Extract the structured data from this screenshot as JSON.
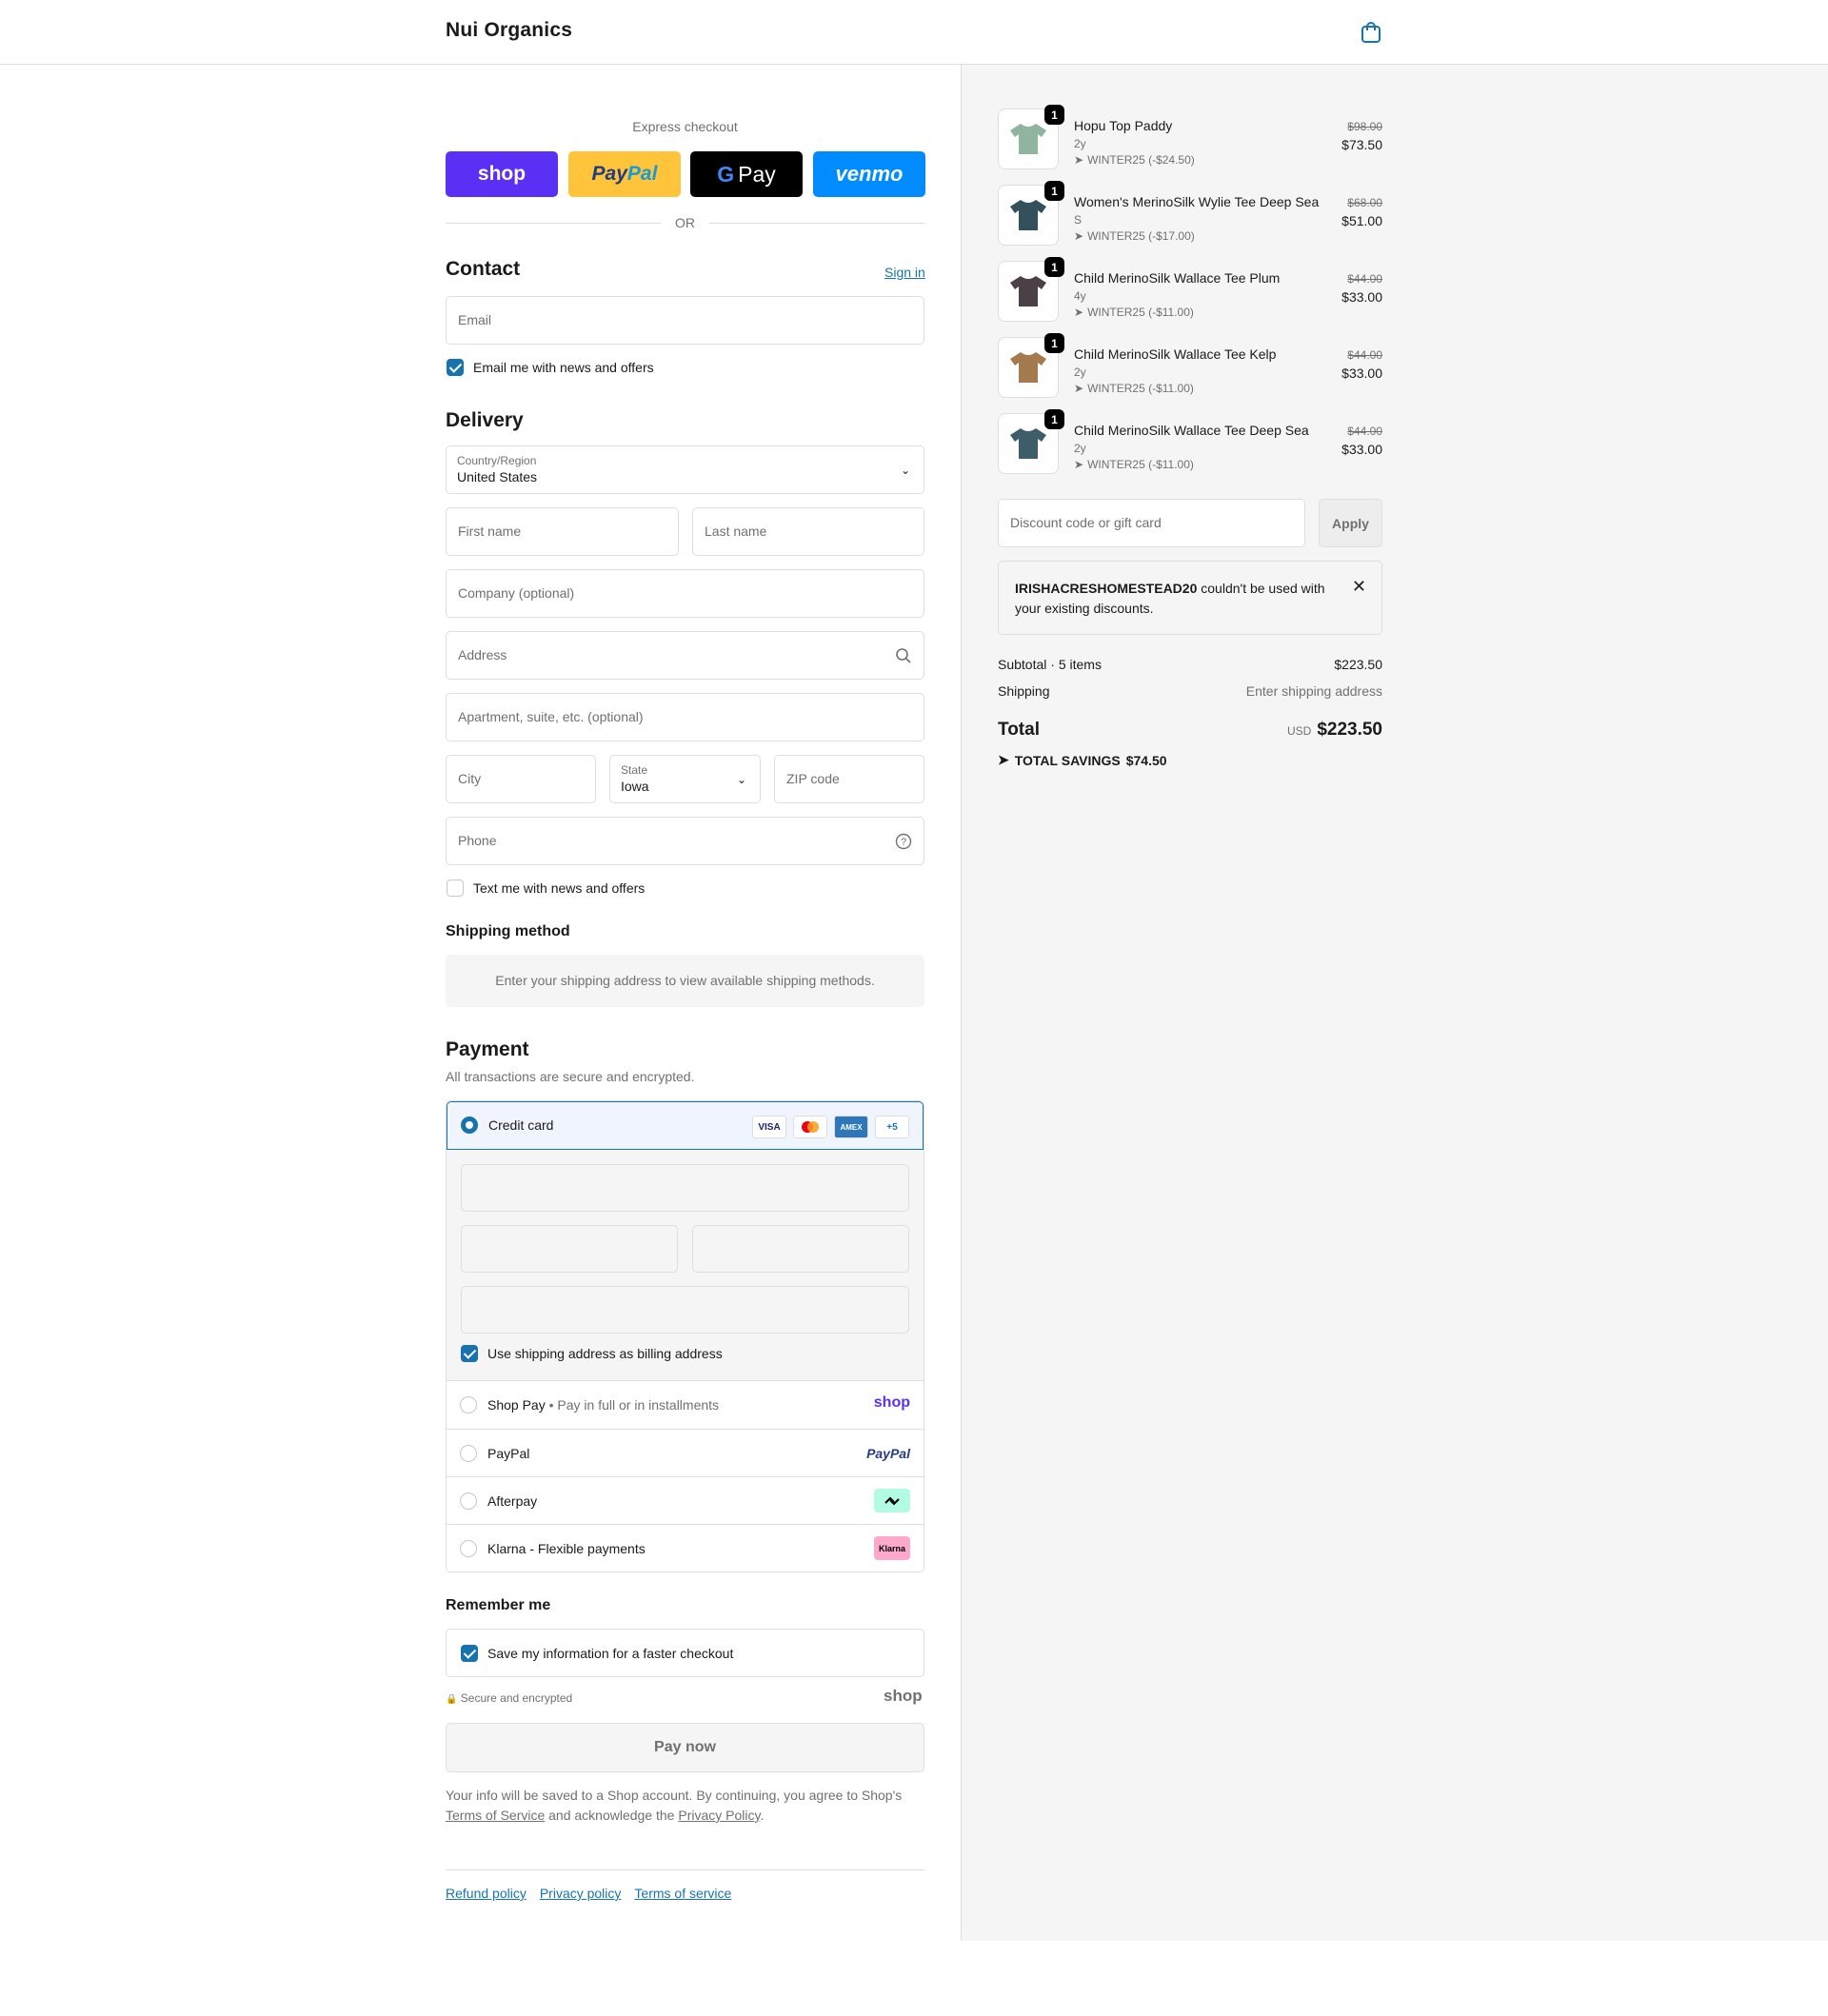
{
  "header": {
    "brand": "Nui Organics"
  },
  "express": {
    "label": "Express checkout",
    "shop": "shop",
    "paypal_a": "Pay",
    "paypal_b": "Pal",
    "gpay_g": "G",
    "gpay": "Pay",
    "venmo": "venmo",
    "or": "OR"
  },
  "contact": {
    "title": "Contact",
    "sign_in": "Sign in",
    "email_placeholder": "Email",
    "email_optin": "Email me with news and offers"
  },
  "delivery": {
    "title": "Delivery",
    "country_label": "Country/Region",
    "country_value": "United States",
    "first_name": "First name",
    "last_name": "Last name",
    "company": "Company (optional)",
    "address": "Address",
    "apartment": "Apartment, suite, etc. (optional)",
    "city": "City",
    "state_label": "State",
    "state_value": "Iowa",
    "zip": "ZIP code",
    "phone": "Phone",
    "text_optin": "Text me with news and offers"
  },
  "shipping_method": {
    "title": "Shipping method",
    "message": "Enter your shipping address to view available shipping methods."
  },
  "payment": {
    "title": "Payment",
    "subtitle": "All transactions are secure and encrypted.",
    "credit_card": "Credit card",
    "cards": [
      "VISA",
      "MC",
      "AMEX",
      "+5"
    ],
    "billing_same": "Use shipping address as billing address",
    "options": [
      {
        "label": "Shop Pay",
        "sub": "Pay in full or in installments",
        "logo": "shop"
      },
      {
        "label": "PayPal",
        "sub": "",
        "logo": "PayPal"
      },
      {
        "label": "Afterpay",
        "sub": "",
        "logo": "afterpay"
      },
      {
        "label": "Klarna - Flexible payments",
        "sub": "",
        "logo": "Klarna"
      }
    ]
  },
  "remember": {
    "title": "Remember me",
    "save_info": "Save my information for a faster checkout",
    "secure": "Secure and encrypted",
    "shop_logo": "shop"
  },
  "pay_now": "Pay now",
  "legal": {
    "text1": "Your info will be saved to a Shop account. By continuing, you agree to Shop's",
    "terms": "Terms of Service",
    "text2": "and acknowledge the",
    "privacy": "Privacy Policy",
    "text3": "."
  },
  "footer": [
    "Refund policy",
    "Privacy policy",
    "Terms of service"
  ],
  "order": {
    "items": [
      {
        "name": "Hopu Top Paddy",
        "variant": "2y",
        "discount": "WINTER25 (-$24.50)",
        "old": "$98.00",
        "price": "$73.50",
        "qty": "1",
        "color": "#8fb4a0"
      },
      {
        "name": "Women's MerinoSilk Wylie Tee Deep Sea",
        "variant": "S",
        "discount": "WINTER25 (-$17.00)",
        "old": "$68.00",
        "price": "$51.00",
        "qty": "1",
        "color": "#33505c"
      },
      {
        "name": "Child MerinoSilk Wallace Tee Plum",
        "variant": "4y",
        "discount": "WINTER25 (-$11.00)",
        "old": "$44.00",
        "price": "$33.00",
        "qty": "1",
        "color": "#4b4048"
      },
      {
        "name": "Child MerinoSilk Wallace Tee Kelp",
        "variant": "2y",
        "discount": "WINTER25 (-$11.00)",
        "old": "$44.00",
        "price": "$33.00",
        "qty": "1",
        "color": "#a47a4f"
      },
      {
        "name": "Child MerinoSilk Wallace Tee Deep Sea",
        "variant": "2y",
        "discount": "WINTER25 (-$11.00)",
        "old": "$44.00",
        "price": "$33.00",
        "qty": "1",
        "color": "#3d5d6a"
      }
    ],
    "discount_placeholder": "Discount code or gift card",
    "apply": "Apply",
    "notice_code": "IRISHACRESHOMESTEAD20",
    "notice_text": " couldn't be used with your existing discounts.",
    "subtotal_label": "Subtotal · 5 items",
    "subtotal": "$223.50",
    "shipping_label": "Shipping",
    "shipping": "Enter shipping address",
    "total_label": "Total",
    "currency": "USD",
    "total": "$223.50",
    "savings_label": "TOTAL SAVINGS",
    "savings": "$74.50"
  },
  "colors": {
    "accent": "#1773b0",
    "shop": "#5a31f4",
    "paypal": "#ffc439",
    "venmo": "#008cff"
  }
}
